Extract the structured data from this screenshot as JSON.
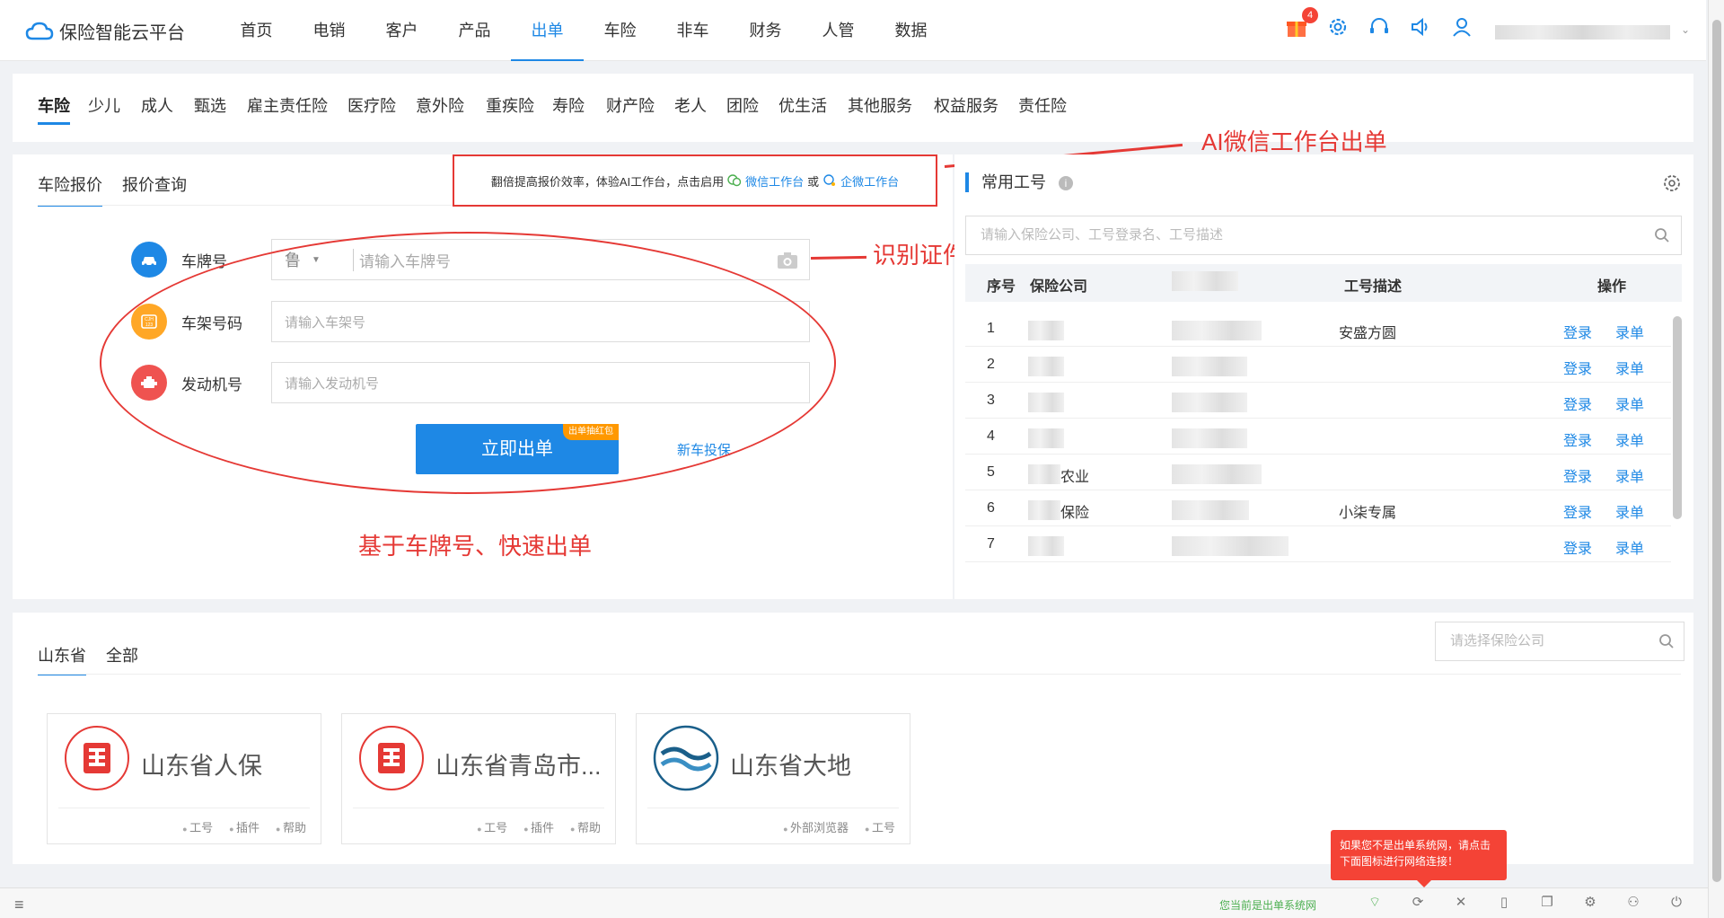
{
  "app": {
    "title": "保险智能云平台",
    "accent": "#1e88e5",
    "annotation_color": "#e53935",
    "gift_badge": "4"
  },
  "nav": {
    "items": [
      "首页",
      "电销",
      "客户",
      "产品",
      "出单",
      "车险",
      "非车",
      "财务",
      "人管",
      "数据"
    ],
    "active": "出单"
  },
  "category_tabs": [
    "车险",
    "少儿",
    "成人",
    "甄选",
    "雇主责任险",
    "医疗险",
    "意外险",
    "重疾险",
    "寿险",
    "财产险",
    "老人",
    "团险",
    "优生活",
    "其他服务",
    "权益服务",
    "责任险"
  ],
  "quote": {
    "tabs": [
      "车险报价",
      "报价查询"
    ],
    "promo_text": "翻倍提高报价效率，体验AI工作台，点击启用",
    "promo_link1": "微信工作台",
    "promo_or": "或",
    "promo_link2": "企微工作台",
    "plate_label": "车牌号",
    "province": "鲁",
    "plate_placeholder": "请输入车牌号",
    "vin_label": "车架号码",
    "vin_placeholder": "请输入车架号",
    "engine_label": "发动机号",
    "engine_placeholder": "请输入发动机号",
    "submit": "立即出单",
    "submit_tag": "出单抽红包",
    "new_car": "新车投保"
  },
  "annotations": {
    "ai": "AI微信工作台出单",
    "id": "识别证件快速出单",
    "plate": "基于车牌号、快速出单"
  },
  "common": {
    "title": "常用工号",
    "search_placeholder": "请输入保险公司、工号登录名、工号描述",
    "headers": {
      "no": "序号",
      "company": "保险公司",
      "desc": "工号描述",
      "op": "操作"
    },
    "rows": [
      {
        "no": "1",
        "company_suffix": "",
        "desc": "安盛方圆"
      },
      {
        "no": "2",
        "company_suffix": "",
        "desc": ""
      },
      {
        "no": "3",
        "company_suffix": "",
        "desc": ""
      },
      {
        "no": "4",
        "company_suffix": "",
        "desc": ""
      },
      {
        "no": "5",
        "company_suffix": "农业",
        "desc": ""
      },
      {
        "no": "6",
        "company_suffix": "保险",
        "desc": "小柒专属"
      },
      {
        "no": "7",
        "company_suffix": "",
        "desc": ""
      }
    ],
    "op_login": "登录",
    "op_entry": "录单"
  },
  "insurers": {
    "tabs": [
      "山东省",
      "全部"
    ],
    "search_placeholder": "请选择保险公司",
    "cards": [
      {
        "name": "山东省人保",
        "foot": [
          "工号",
          "插件",
          "帮助"
        ],
        "logo": "picc"
      },
      {
        "name": "山东省青岛市...",
        "foot": [
          "工号",
          "插件",
          "帮助"
        ],
        "logo": "picc"
      },
      {
        "name": "山东省大地",
        "foot": [
          "外部浏览器",
          "工号"
        ],
        "logo": "dadi"
      }
    ]
  },
  "statusbar": {
    "status_text": "您当前是出单系统网",
    "tooltip": "如果您不是出单系统网，请点击下面图标进行网络连接！"
  }
}
